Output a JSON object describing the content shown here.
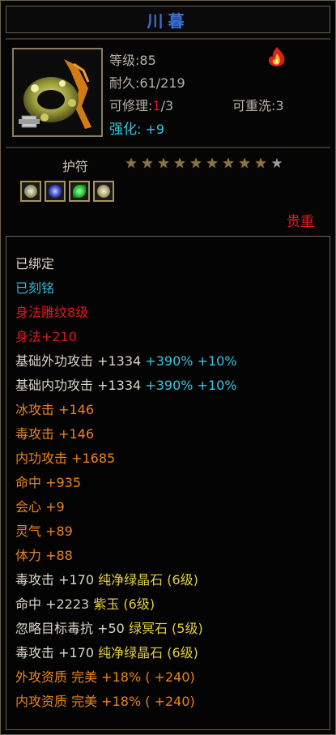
{
  "title": "川暮",
  "stats": {
    "level_label": "等级",
    "level_value": ":85",
    "durability_label": "耐久",
    "durability_value": ":61/219",
    "repair_label": "可修理",
    "repair_colon": ":",
    "repair_current": "1",
    "repair_total": "/3",
    "rewash_label": "可重洗",
    "rewash_value": ":3",
    "enhance_label": "强化",
    "enhance_value": ": +9"
  },
  "amulet": {
    "label": "护符",
    "stars_filled": 9,
    "stars_total": 10
  },
  "gem_icons": [
    "swirl-gem-icon",
    "blue-orb-gem-icon",
    "green-leaf-gem-icon",
    "swirl-gem-icon"
  ],
  "rarity": "贵重",
  "attributes": {
    "bound": "已绑定",
    "engraved": "已刻铭",
    "carve": "身法雕纹8级",
    "agility": "身法+210",
    "ext_attack": {
      "text": "基础外功攻击 +1334 ",
      "pct": "+390% +10%"
    },
    "int_attack": {
      "text": "基础内功攻击 +1334 ",
      "pct": "+390% +10%"
    },
    "ice_attack": "冰攻击 +146",
    "poison_attack": "毒攻击 +146",
    "internal_attack": "内功攻击 +1685",
    "hit": "命中 +935",
    "crit": "会心 +9",
    "spirit": "灵气 +89",
    "stamina": "体力 +88",
    "gem_line_1": {
      "text": "毒攻击 +170 ",
      "gem": "纯净绿晶石 (6级)"
    },
    "gem_line_2": {
      "text": "命中 +2223 ",
      "gem": "紫玉 (6级)"
    },
    "gem_line_3": {
      "text": "忽略目标毒抗 +50 ",
      "gem": "绿冥石 (5级)"
    },
    "gem_line_4": {
      "text": "毒攻击 +170 ",
      "gem": "纯净绿晶石 (6级)"
    },
    "ext_quality": "外攻资质  完美 +18% ( +240)",
    "int_quality": "内攻资质  完美 +18% ( +240)"
  },
  "colors": {
    "title": "#3b6fd6",
    "rarity": "#e01b1b",
    "cyan": "#35c7e0",
    "orange": "#e8851c",
    "yellow": "#e3cf3f"
  }
}
